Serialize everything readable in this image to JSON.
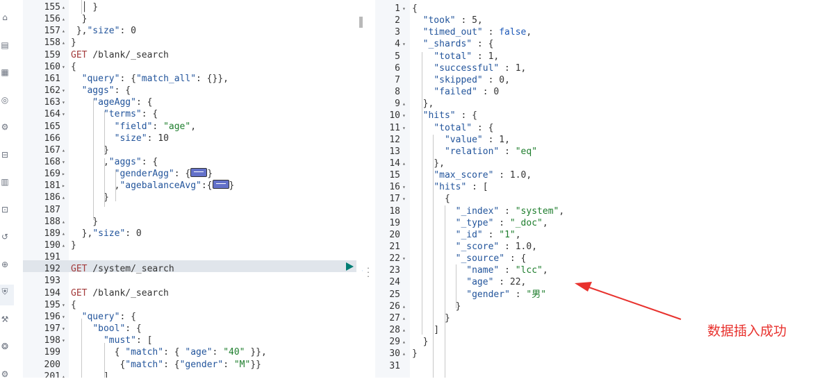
{
  "console": {
    "request_lines": [
      {
        "n": "155",
        "f": "▴",
        "t": [
          [
            "p",
            "  │ }"
          ]
        ]
      },
      {
        "n": "156",
        "f": "▴",
        "t": [
          [
            "p",
            "  }"
          ]
        ]
      },
      {
        "n": "157",
        "f": "▴",
        "t": [
          [
            "p",
            " },"
          ],
          [
            "k",
            "\"size\""
          ],
          [
            "p",
            ": 0"
          ]
        ]
      },
      {
        "n": "158",
        "f": "▴",
        "t": [
          [
            "p",
            "}"
          ]
        ]
      },
      {
        "n": "159",
        "f": "",
        "t": [
          [
            "m",
            "GET"
          ],
          [
            "p",
            " /blank/_search"
          ]
        ]
      },
      {
        "n": "160",
        "f": "▾",
        "t": [
          [
            "p",
            "{"
          ]
        ]
      },
      {
        "n": "161",
        "f": "",
        "t": [
          [
            "p",
            "  "
          ],
          [
            "k",
            "\"query\""
          ],
          [
            "p",
            ": {"
          ],
          [
            "k",
            "\"match_all\""
          ],
          [
            "p",
            ": {}},"
          ]
        ]
      },
      {
        "n": "162",
        "f": "▾",
        "t": [
          [
            "p",
            "  "
          ],
          [
            "k",
            "\"aggs\""
          ],
          [
            "p",
            ": {"
          ]
        ]
      },
      {
        "n": "163",
        "f": "▾",
        "t": [
          [
            "p",
            "    "
          ],
          [
            "k",
            "\"ageAgg\""
          ],
          [
            "p",
            ": {"
          ]
        ]
      },
      {
        "n": "164",
        "f": "▾",
        "t": [
          [
            "p",
            "      "
          ],
          [
            "k",
            "\"terms\""
          ],
          [
            "p",
            ": {"
          ]
        ]
      },
      {
        "n": "165",
        "f": "",
        "t": [
          [
            "p",
            "        "
          ],
          [
            "k",
            "\"field\""
          ],
          [
            "p",
            ": "
          ],
          [
            "s",
            "\"age\""
          ],
          [
            "p",
            ","
          ]
        ]
      },
      {
        "n": "166",
        "f": "",
        "t": [
          [
            "p",
            "        "
          ],
          [
            "k",
            "\"size\""
          ],
          [
            "p",
            ": 10"
          ]
        ]
      },
      {
        "n": "167",
        "f": "▴",
        "t": [
          [
            "p",
            "      }"
          ]
        ]
      },
      {
        "n": "168",
        "f": "▾",
        "t": [
          [
            "p",
            "      ,"
          ],
          [
            "k",
            "\"aggs\""
          ],
          [
            "p",
            ": {"
          ]
        ]
      },
      {
        "n": "169",
        "f": "▸",
        "t": [
          [
            "p",
            "        "
          ],
          [
            "k",
            "\"genderAgg\""
          ],
          [
            "p",
            ": {"
          ],
          [
            "badge",
            ""
          ],
          [
            "p",
            "}"
          ]
        ]
      },
      {
        "n": "181",
        "f": "▸",
        "t": [
          [
            "p",
            "        ,"
          ],
          [
            "k",
            "\"agebalanceAvg\""
          ],
          [
            "p",
            ":{"
          ],
          [
            "badge",
            ""
          ],
          [
            "p",
            "}"
          ]
        ]
      },
      {
        "n": "186",
        "f": "▴",
        "t": [
          [
            "p",
            "      }"
          ]
        ]
      },
      {
        "n": "187",
        "f": "",
        "t": []
      },
      {
        "n": "188",
        "f": "▴",
        "t": [
          [
            "p",
            "    }"
          ]
        ]
      },
      {
        "n": "189",
        "f": "▴",
        "t": [
          [
            "p",
            "  },"
          ],
          [
            "k",
            "\"size\""
          ],
          [
            "p",
            ": 0"
          ]
        ]
      },
      {
        "n": "190",
        "f": "▴",
        "t": [
          [
            "p",
            "}"
          ]
        ]
      },
      {
        "n": "191",
        "f": "",
        "t": []
      },
      {
        "n": "192",
        "f": "",
        "t": [
          [
            "m",
            "GET"
          ],
          [
            "p",
            " /system/_search"
          ]
        ]
      },
      {
        "n": "193",
        "f": "",
        "t": []
      },
      {
        "n": "194",
        "f": "",
        "t": [
          [
            "m",
            "GET"
          ],
          [
            "p",
            " /blank/_search"
          ]
        ]
      },
      {
        "n": "195",
        "f": "▾",
        "t": [
          [
            "p",
            "{"
          ]
        ]
      },
      {
        "n": "196",
        "f": "▾",
        "t": [
          [
            "p",
            "  "
          ],
          [
            "k",
            "\"query\""
          ],
          [
            "p",
            ": {"
          ]
        ]
      },
      {
        "n": "197",
        "f": "▾",
        "t": [
          [
            "p",
            "    "
          ],
          [
            "k",
            "\"bool\""
          ],
          [
            "p",
            ": {"
          ]
        ]
      },
      {
        "n": "198",
        "f": "▾",
        "t": [
          [
            "p",
            "      "
          ],
          [
            "k",
            "\"must\""
          ],
          [
            "p",
            ": ["
          ]
        ]
      },
      {
        "n": "199",
        "f": "",
        "t": [
          [
            "p",
            "        { "
          ],
          [
            "k",
            "\"match\""
          ],
          [
            "p",
            ": { "
          ],
          [
            "k",
            "\"age\""
          ],
          [
            "p",
            ": "
          ],
          [
            "s",
            "\"40\""
          ],
          [
            "p",
            " }},"
          ]
        ]
      },
      {
        "n": "200",
        "f": "",
        "t": [
          [
            "p",
            "         {"
          ],
          [
            "k",
            "\"match\""
          ],
          [
            "p",
            ": {"
          ],
          [
            "k",
            "\"gender\""
          ],
          [
            "p",
            ": "
          ],
          [
            "s",
            "\"M\""
          ],
          [
            "p",
            "}}"
          ]
        ]
      },
      {
        "n": "201",
        "f": "▴",
        "t": [
          [
            "p",
            "      ],"
          ]
        ]
      }
    ],
    "response_lines": [
      {
        "n": "1",
        "f": "▾",
        "t": [
          [
            "p",
            "{"
          ]
        ]
      },
      {
        "n": "2",
        "f": "",
        "t": [
          [
            "p",
            "  "
          ],
          [
            "k",
            "\"took\""
          ],
          [
            "p",
            " : 5,"
          ]
        ]
      },
      {
        "n": "3",
        "f": "",
        "t": [
          [
            "p",
            "  "
          ],
          [
            "k",
            "\"timed_out\""
          ],
          [
            "p",
            " : "
          ],
          [
            "b",
            "false"
          ],
          [
            "p",
            ","
          ]
        ]
      },
      {
        "n": "4",
        "f": "▾",
        "t": [
          [
            "p",
            "  "
          ],
          [
            "k",
            "\"_shards\""
          ],
          [
            "p",
            " : {"
          ]
        ]
      },
      {
        "n": "5",
        "f": "",
        "t": [
          [
            "p",
            "    "
          ],
          [
            "k",
            "\"total\""
          ],
          [
            "p",
            " : 1,"
          ]
        ]
      },
      {
        "n": "6",
        "f": "",
        "t": [
          [
            "p",
            "    "
          ],
          [
            "k",
            "\"successful\""
          ],
          [
            "p",
            " : 1,"
          ]
        ]
      },
      {
        "n": "7",
        "f": "",
        "t": [
          [
            "p",
            "    "
          ],
          [
            "k",
            "\"skipped\""
          ],
          [
            "p",
            " : 0,"
          ]
        ]
      },
      {
        "n": "8",
        "f": "",
        "t": [
          [
            "p",
            "    "
          ],
          [
            "k",
            "\"failed\""
          ],
          [
            "p",
            " : 0"
          ]
        ]
      },
      {
        "n": "9",
        "f": "▴",
        "t": [
          [
            "p",
            "  },"
          ]
        ]
      },
      {
        "n": "10",
        "f": "▾",
        "t": [
          [
            "p",
            "  "
          ],
          [
            "k",
            "\"hits\""
          ],
          [
            "p",
            " : {"
          ]
        ]
      },
      {
        "n": "11",
        "f": "▾",
        "t": [
          [
            "p",
            "    "
          ],
          [
            "k",
            "\"total\""
          ],
          [
            "p",
            " : {"
          ]
        ]
      },
      {
        "n": "12",
        "f": "",
        "t": [
          [
            "p",
            "      "
          ],
          [
            "k",
            "\"value\""
          ],
          [
            "p",
            " : 1,"
          ]
        ]
      },
      {
        "n": "13",
        "f": "",
        "t": [
          [
            "p",
            "      "
          ],
          [
            "k",
            "\"relation\""
          ],
          [
            "p",
            " : "
          ],
          [
            "s",
            "\"eq\""
          ]
        ]
      },
      {
        "n": "14",
        "f": "▴",
        "t": [
          [
            "p",
            "    },"
          ]
        ]
      },
      {
        "n": "15",
        "f": "",
        "t": [
          [
            "p",
            "    "
          ],
          [
            "k",
            "\"max_score\""
          ],
          [
            "p",
            " : 1.0,"
          ]
        ]
      },
      {
        "n": "16",
        "f": "▾",
        "t": [
          [
            "p",
            "    "
          ],
          [
            "k",
            "\"hits\""
          ],
          [
            "p",
            " : ["
          ]
        ]
      },
      {
        "n": "17",
        "f": "▾",
        "t": [
          [
            "p",
            "      {"
          ]
        ]
      },
      {
        "n": "18",
        "f": "",
        "t": [
          [
            "p",
            "        "
          ],
          [
            "k",
            "\"_index\""
          ],
          [
            "p",
            " : "
          ],
          [
            "s",
            "\"system\""
          ],
          [
            "p",
            ","
          ]
        ]
      },
      {
        "n": "19",
        "f": "",
        "t": [
          [
            "p",
            "        "
          ],
          [
            "k",
            "\"_type\""
          ],
          [
            "p",
            " : "
          ],
          [
            "s",
            "\"_doc\""
          ],
          [
            "p",
            ","
          ]
        ]
      },
      {
        "n": "20",
        "f": "",
        "t": [
          [
            "p",
            "        "
          ],
          [
            "k",
            "\"_id\""
          ],
          [
            "p",
            " : "
          ],
          [
            "s",
            "\"1\""
          ],
          [
            "p",
            ","
          ]
        ]
      },
      {
        "n": "21",
        "f": "",
        "t": [
          [
            "p",
            "        "
          ],
          [
            "k",
            "\"_score\""
          ],
          [
            "p",
            " : 1.0,"
          ]
        ]
      },
      {
        "n": "22",
        "f": "▾",
        "t": [
          [
            "p",
            "        "
          ],
          [
            "k",
            "\"_source\""
          ],
          [
            "p",
            " : {"
          ]
        ]
      },
      {
        "n": "23",
        "f": "",
        "t": [
          [
            "p",
            "          "
          ],
          [
            "k",
            "\"name\""
          ],
          [
            "p",
            " : "
          ],
          [
            "s",
            "\"lcc\""
          ],
          [
            "p",
            ","
          ]
        ]
      },
      {
        "n": "24",
        "f": "",
        "t": [
          [
            "p",
            "          "
          ],
          [
            "k",
            "\"age\""
          ],
          [
            "p",
            " : 22,"
          ]
        ]
      },
      {
        "n": "25",
        "f": "",
        "t": [
          [
            "p",
            "          "
          ],
          [
            "k",
            "\"gender\""
          ],
          [
            "p",
            " : "
          ],
          [
            "s",
            "\"男\""
          ]
        ]
      },
      {
        "n": "26",
        "f": "▴",
        "t": [
          [
            "p",
            "        }"
          ]
        ]
      },
      {
        "n": "27",
        "f": "▴",
        "t": [
          [
            "p",
            "      }"
          ]
        ]
      },
      {
        "n": "28",
        "f": "▴",
        "t": [
          [
            "p",
            "    ]"
          ]
        ]
      },
      {
        "n": "29",
        "f": "▴",
        "t": [
          [
            "p",
            "  }"
          ]
        ]
      },
      {
        "n": "30",
        "f": "▴",
        "t": [
          [
            "p",
            "}"
          ]
        ]
      },
      {
        "n": "31",
        "f": "",
        "t": []
      }
    ]
  },
  "annotation": {
    "text": "数据插入成功",
    "color": "#e8322e"
  },
  "icons": [
    "home-icon",
    "discover-icon",
    "dashboard-icon",
    "canvas-icon",
    "maps-icon",
    "ml-icon",
    "logs-icon",
    "metrics-icon",
    "apm-icon",
    "uptime-icon",
    "security-icon",
    "dev-tools-icon",
    "monitoring-icon",
    "settings-icon"
  ]
}
